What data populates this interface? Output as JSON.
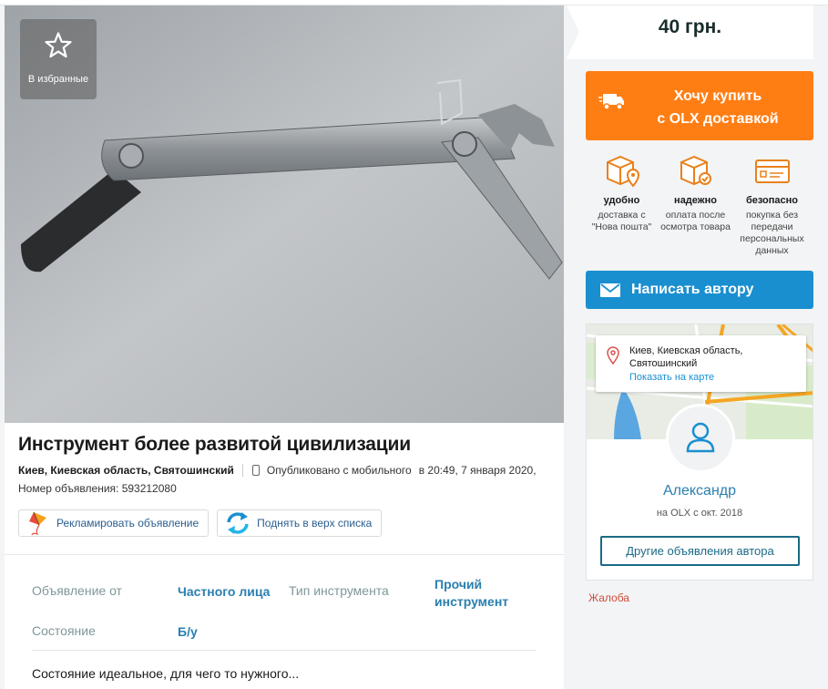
{
  "favorite": {
    "label": "В избранные",
    "icon": "star-icon"
  },
  "ad": {
    "title": "Инструмент более развитой цивилизации",
    "location": "Киев, Киевская область, Святошинский",
    "published": "Опубликовано с мобильного",
    "date": "в 20:49, 7 января 2020,",
    "ad_number": "Номер объявления: 593212080"
  },
  "promo_buttons": {
    "advertise": "Рекламировать объявление",
    "raise": "Поднять в верх списка"
  },
  "details": {
    "from_label": "Объявление от",
    "from_value": "Частного лица",
    "type_label": "Тип инструмента",
    "type_value": "Прочий инструмент",
    "condition_label": "Состояние",
    "condition_value": "Б/у"
  },
  "description": "Состояние идеальное, для чего то нужного...",
  "price": "40 грн.",
  "buy_button": {
    "line1": "Хочу купить",
    "line2": "с OLX доставкой"
  },
  "features": [
    {
      "title": "удобно",
      "text": "доставка с \"Нова пошта\"",
      "icon": "box-pin-icon"
    },
    {
      "title": "надежно",
      "text": "оплата после осмотра товара",
      "icon": "box-check-icon"
    },
    {
      "title": "безопасно",
      "text": "покупка без передачи персональных данных",
      "icon": "card-icon"
    }
  ],
  "write_button": "Написать автору",
  "map": {
    "address": "Киев, Киевская область, Святошинский",
    "show_on_map": "Показать на карте"
  },
  "seller": {
    "name": "Александр",
    "since": "на OLX с окт. 2018",
    "other_ads": "Другие объявления автора"
  },
  "complain": "Жалоба",
  "colors": {
    "orange": "#ff7e14",
    "blue": "#1a8fd0",
    "teal": "#1a6a85"
  }
}
